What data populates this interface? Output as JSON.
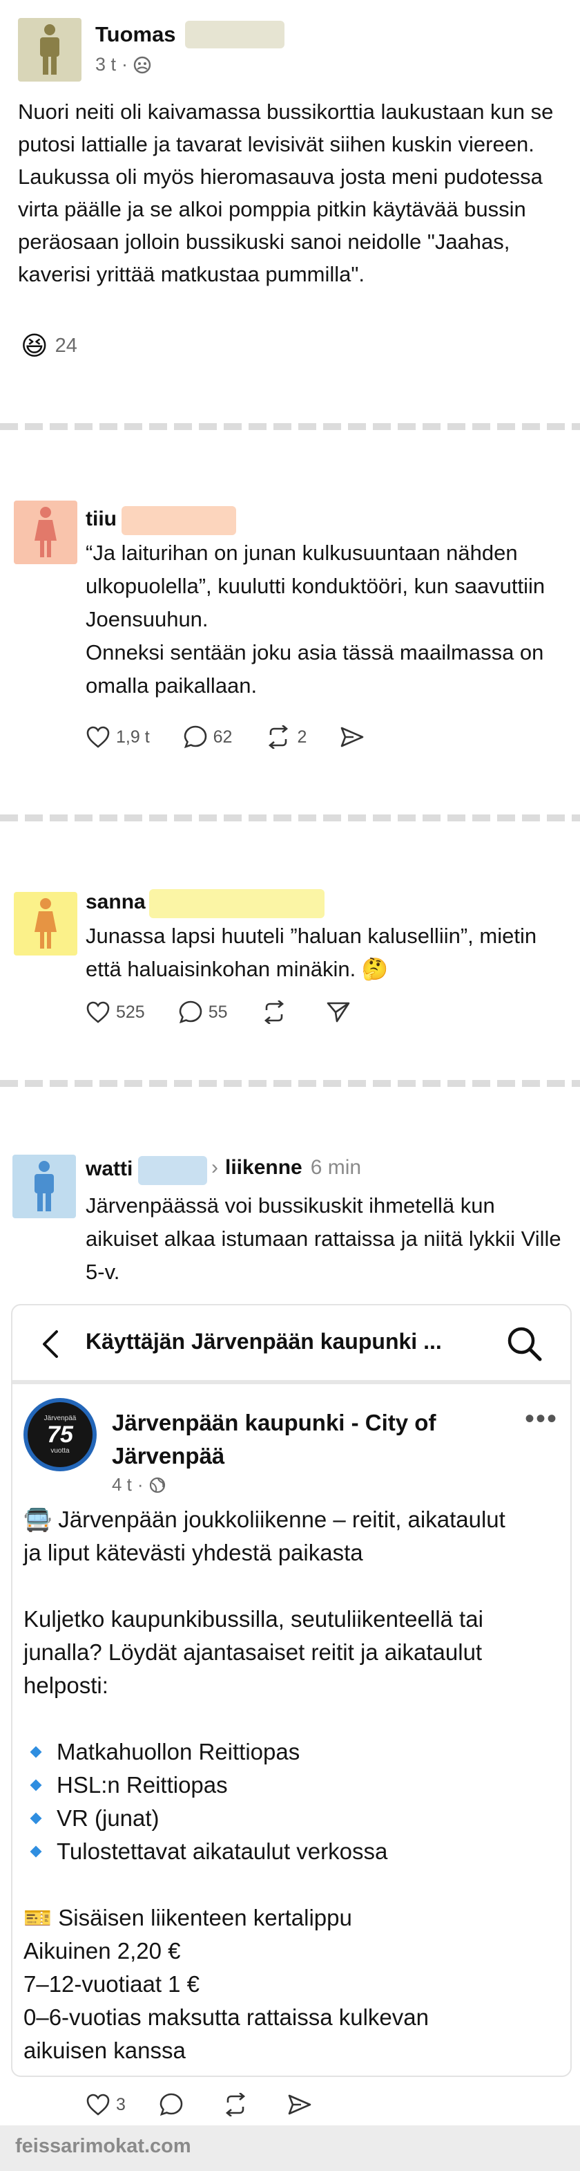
{
  "posts": [
    {
      "author": "Tuomas",
      "time": "3 t",
      "text": "Nuori neiti oli kaivamassa bussikorttia laukustaan kun se putosi lattialle ja tavarat levisivät siihen kuskin viereen. Laukussa oli myös hieromasauva josta meni pudotessa virta päälle ja se alkoi pomppia pitkin käytävää bussin peräosaan jolloin bussikuski sanoi neidolle \"Jaahas, kaverisi yrittää matkustaa pummilla\".",
      "reaction_count": "24",
      "reaction_emoji": "😆"
    },
    {
      "author": "tiiu",
      "text": "“Ja laiturihan on junan kulkusuuntaan nähden ulkopuolella”, kuulutti konduktööri, kun saavuttiin Joensuuhun.\nOnneksi sentään joku asia tässä maailmassa on omalla paikallaan.",
      "likes": "1,9 t",
      "comments": "62",
      "reposts": "2"
    },
    {
      "author": "sanna",
      "text": "Junassa lapsi huuteli ”haluan kaluselliin”, mietin että haluaisinkohan minäkin. 🤔",
      "likes": "525",
      "comments": "55"
    },
    {
      "author": "watti",
      "community": "liikenne",
      "time": "6 min",
      "text": "Järvenpäässä voi bussikuskit ihmetellä kun aikuiset alkaa istumaan rattaissa ja niitä lykkii Ville 5-v.",
      "likes": "3"
    }
  ],
  "embed": {
    "header_title": "Käyttäjän Järvenpään kaupunki ...",
    "page_name": "Järvenpään kaupunki - City of Järvenpää",
    "time": "4 t",
    "logo_number": "75",
    "logo_top": "Järvenpää",
    "logo_bottom": "vuotta",
    "lines": [
      "🚍 Järvenpään joukkoliikenne – reitit, aikataulut",
      "ja liput kätevästi yhdestä paikasta",
      "",
      "Kuljetko kaupunkibussilla, seutuliikenteellä tai",
      "junalla? Löydät ajantasaiset reitit ja aikataulut",
      "helposti:",
      ""
    ],
    "bullets": [
      "Matkahuollon Reittiopas",
      "HSL:n Reittiopas",
      "VR (junat)",
      "Tulostettavat aikataulut verkossa"
    ],
    "ticket_lines": [
      "🎫 Sisäisen liikenteen kertalippu",
      "Aikuinen 2,20 €",
      "7–12-vuotiaat 1 €",
      "0–6-vuotias maksutta rattaissa kulkevan",
      "aikuisen kanssa"
    ]
  },
  "watermark": "feissarimokat.com",
  "colors": {
    "avatar_olive": "#d9d6b8",
    "avatar_salmon": "#f9c4ac",
    "avatar_yellow": "#fbf18a",
    "avatar_blue": "#c0dcef",
    "redact_beige": "#e6e4d2",
    "redact_peach": "#fcd5bd",
    "redact_yellow": "#fbf5a5",
    "redact_blue": "#c9e0f1"
  }
}
